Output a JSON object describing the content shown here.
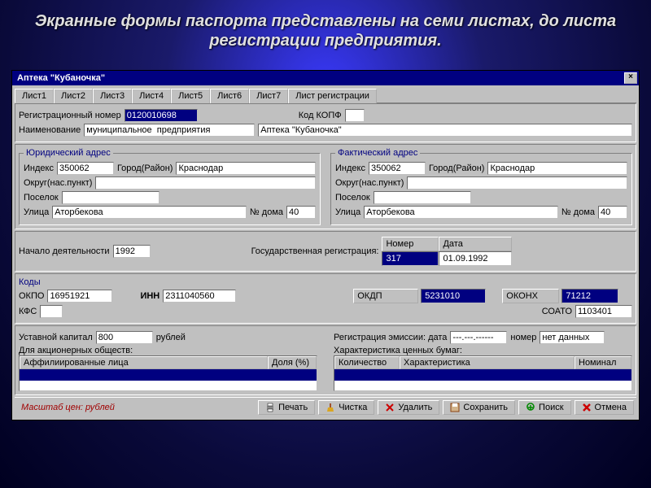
{
  "slide": {
    "title": "Экранные формы паспорта представлены на семи листах, до листа регистрации предприятия."
  },
  "window": {
    "title": "Аптека \"Кубаночка\""
  },
  "tabs": [
    "Лист1",
    "Лист2",
    "Лист3",
    "Лист4",
    "Лист5",
    "Лист6",
    "Лист7",
    "Лист регистрации"
  ],
  "reg": {
    "reg_num_label": "Регистрационный номер",
    "reg_num": "0120010698",
    "kopf_label": "Код  КОПФ",
    "kopf": "",
    "name_label": "Наименование",
    "org_form": "муниципальное  предприятия",
    "org_name": "Аптека \"Кубаночка\""
  },
  "addr": {
    "legal_title": "Юридический адрес",
    "actual_title": "Фактический адрес",
    "index_label": "Индекс",
    "city_label": "Город(Район)",
    "okrug_label": "Округ(нас.пункт)",
    "poselok_label": "Поселок",
    "street_label": "Улица",
    "house_label": "№ дома",
    "legal": {
      "index": "350062",
      "city": "Краснодар",
      "okrug": "",
      "poselok": "",
      "street": "Аторбекова",
      "house": "40"
    },
    "actual": {
      "index": "350062",
      "city": "Краснодар",
      "okrug": "",
      "poselok": "",
      "street": "Аторбекова",
      "house": "40"
    }
  },
  "activity": {
    "start_label": "Начало деятельности",
    "start_year": "1992",
    "gosreg_label": "Государственная регистрация:",
    "head_num": "Номер",
    "head_date": "Дата",
    "num": "317",
    "date": "01.09.1992"
  },
  "codes": {
    "title": "Коды",
    "okpo_label": "ОКПО",
    "okpo": "16951921",
    "inn_label": "ИНН",
    "inn": "2311040560",
    "kfs_label": "КФС",
    "kfs": "",
    "okdp_label": "ОКДП",
    "okdp": "5231010",
    "okonh_label": "ОКОНХ",
    "okonh": "71212",
    "soato_label": "СОАТО",
    "soato": "1103401"
  },
  "capital": {
    "ust_label": "Уставной капитал",
    "ust_value": "800",
    "ust_unit": "рублей",
    "ao_label": "Для акционерных обществ:",
    "affil_head": "Аффилиированные лица",
    "share_head": "Доля (%)",
    "emission_label": "Регистрация эмиссии: дата",
    "emission_date": "---.---.------",
    "emission_num_label": "номер",
    "emission_num": "нет данных",
    "sec_label": "Характеристика ценных бумаг:",
    "sec_qty": "Количество",
    "sec_char": "Характеристика",
    "sec_nom": "Номинал"
  },
  "footer": {
    "scale": "Масштаб цен: рублей",
    "print": "Печать",
    "clear": "Чистка",
    "delete": "Удалить",
    "save": "Сохранить",
    "search": "Поиск",
    "cancel": "Отмена"
  }
}
